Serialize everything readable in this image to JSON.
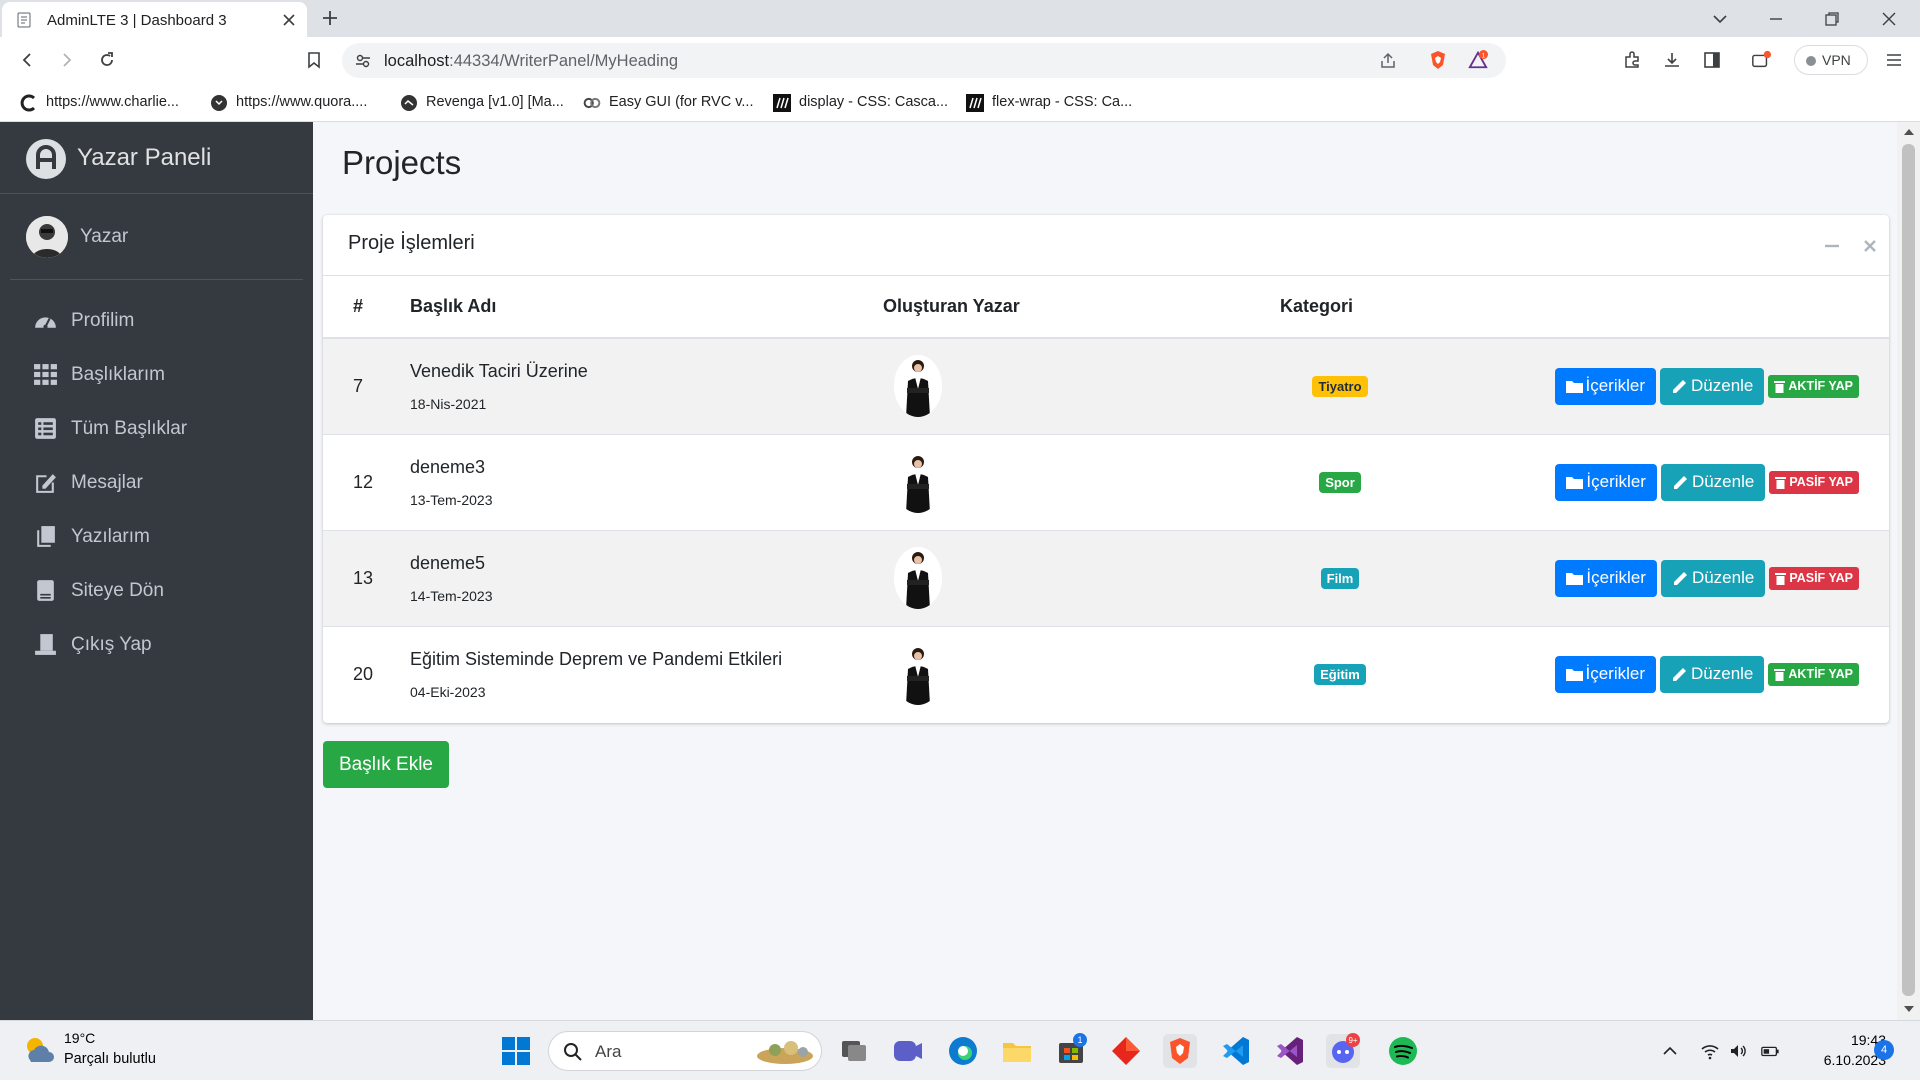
{
  "browser": {
    "tab_title": "AdminLTE 3 | Dashboard 3",
    "url_host": "localhost",
    "url_rest": ":44334/WriterPanel/MyHeading",
    "vpn_label": "VPN",
    "bookmarks": [
      {
        "label": "https://www.charlie...",
        "icon": "charlie-icon"
      },
      {
        "label": "https://www.quora....",
        "icon": "quora-icon"
      },
      {
        "label": "Revenga [v1.0] [Ma...",
        "icon": "revenga-icon"
      },
      {
        "label": "Easy GUI (for RVC v...",
        "icon": "colab-icon"
      },
      {
        "label": "display - CSS: Casca...",
        "icon": "mdn-icon"
      },
      {
        "label": "flex-wrap - CSS: Ca...",
        "icon": "mdn-icon"
      }
    ]
  },
  "sidebar": {
    "brand": "Yazar Paneli",
    "user": "Yazar",
    "items": [
      {
        "label": "Profilim",
        "icon": "dashboard-icon"
      },
      {
        "label": "Başlıklarım",
        "icon": "grid-icon"
      },
      {
        "label": "Tüm Başlıklar",
        "icon": "list-icon"
      },
      {
        "label": "Mesajlar",
        "icon": "edit-icon"
      },
      {
        "label": "Yazılarım",
        "icon": "copy-icon"
      },
      {
        "label": "Siteye Dön",
        "icon": "book-icon"
      },
      {
        "label": "Çıkış Yap",
        "icon": "user-icon"
      }
    ]
  },
  "main": {
    "page_title": "Projects",
    "card_title": "Proje İşlemleri",
    "columns": [
      "#",
      "Başlık Adı",
      "Oluşturan Yazar",
      "Kategori"
    ],
    "rows": [
      {
        "id": "7",
        "title": "Venedik Taciri Üzerine",
        "date": "18-Nis-2021",
        "category": "Tiyatro",
        "category_color": "warning",
        "status_label": "AKTİF YAP",
        "status_color": "success"
      },
      {
        "id": "12",
        "title": "deneme3",
        "date": "13-Tem-2023",
        "category": "Spor",
        "category_color": "success",
        "status_label": "PASİF YAP",
        "status_color": "danger"
      },
      {
        "id": "13",
        "title": "deneme5",
        "date": "14-Tem-2023",
        "category": "Film",
        "category_color": "info",
        "status_label": "PASİF YAP",
        "status_color": "danger"
      },
      {
        "id": "20",
        "title": "Eğitim Sisteminde Deprem ve Pandemi Etkileri",
        "date": "04-Eki-2023",
        "category": "Eğitim",
        "category_color": "info",
        "status_label": "AKTİF YAP",
        "status_color": "success"
      }
    ],
    "btn_contents": "İçerikler",
    "btn_edit": "Düzenle",
    "add_button": "Başlık Ekle"
  },
  "taskbar": {
    "temperature": "19°C",
    "condition": "Parçalı bulutlu",
    "search_placeholder": "Ara",
    "time": "19:43",
    "date": "6.10.2023",
    "notification_count": "4",
    "store_badge": "1",
    "discord_badge": "9+"
  },
  "colors": {
    "sidebar_bg": "#343a40",
    "primary": "#007bff",
    "info": "#17a2b8",
    "success": "#28a745",
    "danger": "#dc3545",
    "warning": "#ffc107"
  }
}
